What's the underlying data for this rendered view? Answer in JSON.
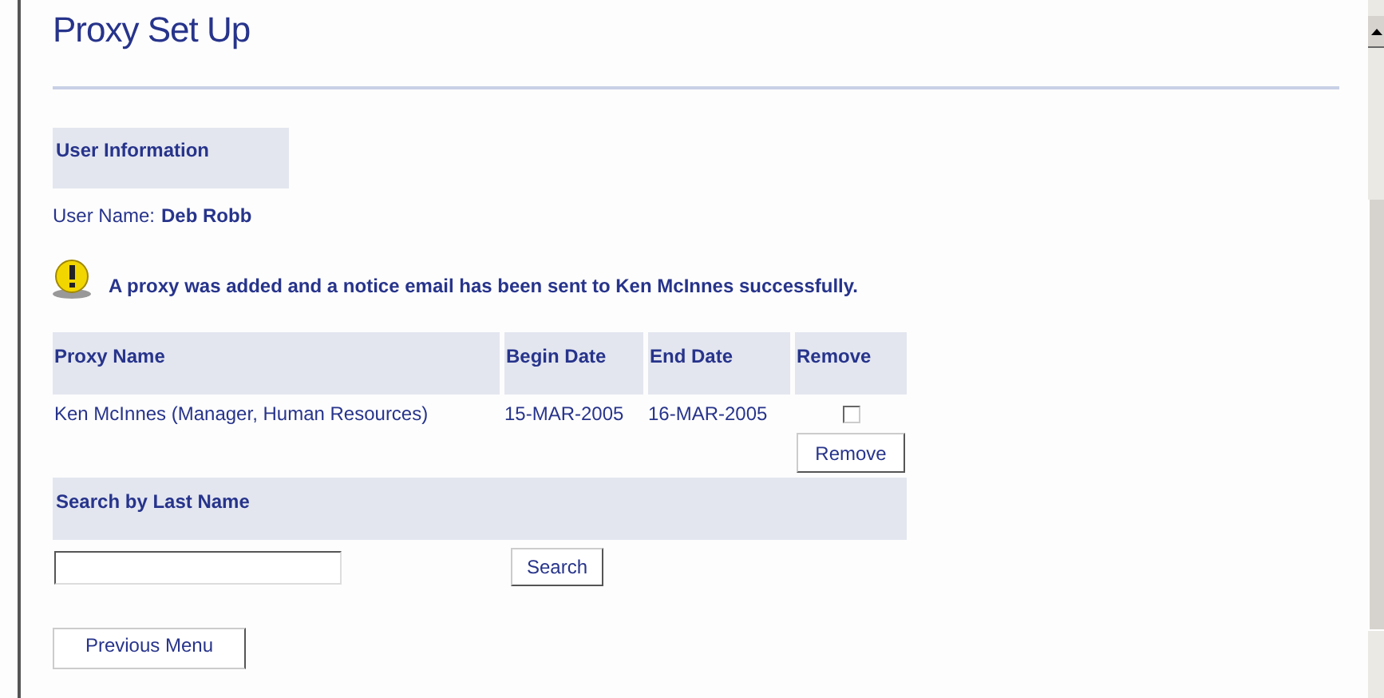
{
  "page_title": "Proxy Set Up",
  "user_information": {
    "heading": "User Information",
    "label": "User Name:",
    "value": "Deb Robb"
  },
  "notice": {
    "text": "A proxy was added and a notice email has been sent to Ken McInnes successfully."
  },
  "proxy_table": {
    "columns": [
      "Proxy Name",
      "Begin Date",
      "End Date",
      "Remove"
    ],
    "rows": [
      {
        "name": "Ken McInnes (Manager, Human Resources)",
        "begin": "15-MAR-2005",
        "end": "16-MAR-2005",
        "checked": false
      }
    ],
    "remove_button": "Remove"
  },
  "search": {
    "heading": "Search by Last Name",
    "button": "Search"
  },
  "previous_button": "Previous Menu"
}
